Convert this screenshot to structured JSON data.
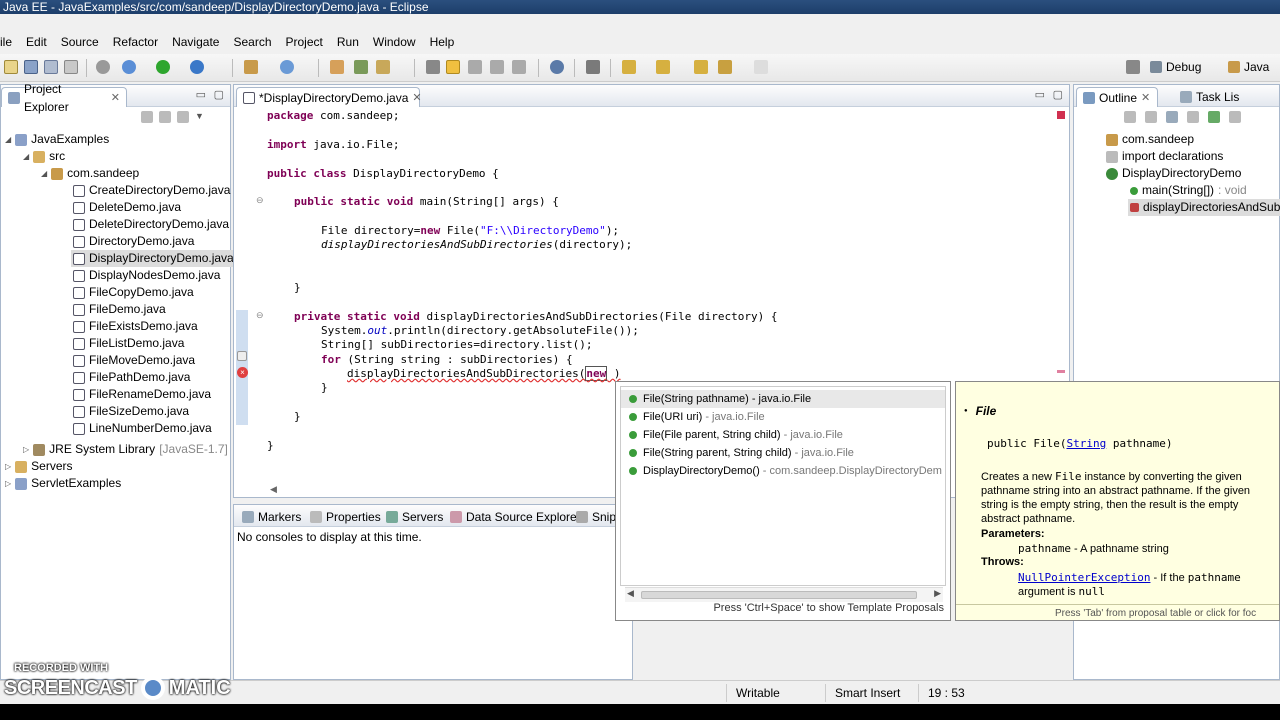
{
  "window": {
    "title": "Java EE - JavaExamples/src/com/sandeep/DisplayDirectoryDemo.java - Eclipse"
  },
  "menu": [
    "ile",
    "Edit",
    "Source",
    "Refactor",
    "Navigate",
    "Search",
    "Project",
    "Run",
    "Window",
    "Help"
  ],
  "perspectives": {
    "debug": "Debug",
    "java": "Java"
  },
  "project_explorer": {
    "tab": "Project Explorer",
    "items": [
      {
        "label": "JavaExamples"
      },
      {
        "label": "src"
      },
      {
        "label": "com.sandeep"
      },
      {
        "label": "CreateDirectoryDemo.java"
      },
      {
        "label": "DeleteDemo.java"
      },
      {
        "label": "DeleteDirectoryDemo.java"
      },
      {
        "label": "DirectoryDemo.java"
      },
      {
        "label": "DisplayDirectoryDemo.java"
      },
      {
        "label": "DisplayNodesDemo.java"
      },
      {
        "label": "FileCopyDemo.java"
      },
      {
        "label": "FileDemo.java"
      },
      {
        "label": "FileExistsDemo.java"
      },
      {
        "label": "FileListDemo.java"
      },
      {
        "label": "FileMoveDemo.java"
      },
      {
        "label": "FilePathDemo.java"
      },
      {
        "label": "FileRenameDemo.java"
      },
      {
        "label": "FileSizeDemo.java"
      },
      {
        "label": "LineNumberDemo.java"
      },
      {
        "label": "JRE System Library",
        "suffix": "[JavaSE-1.7]"
      },
      {
        "label": "Servers"
      },
      {
        "label": "ServletExamples"
      }
    ]
  },
  "editor": {
    "tab": "*DisplayDirectoryDemo.java",
    "lines": {
      "l1a": "package",
      "l1b": " com.sandeep;",
      "l2a": "import",
      "l2b": " java.io.File;",
      "l3a": "public class",
      "l3b": " DisplayDirectoryDemo {",
      "l4a": "public static void",
      "l4b": " main(String[] args) {",
      "l5a": "File directory=",
      "l5b": "new",
      "l5c": " File(",
      "l5d": "\"F:\\\\DirectoryDemo\"",
      "l5e": ");",
      "l6a": "displayDirectoriesAndSubDirectories",
      "l6b": "(directory);",
      "l7": "}",
      "l8a": "private static void",
      "l8b": " displayDirectoriesAndSubDirectories(File directory) {",
      "l9a": "System.",
      "l9b": "out",
      "l9c": ".println(directory.getAbsoluteFile());",
      "l10": "String[] subDirectories=directory.list();",
      "l11a": "for",
      "l11b": " (String string : subDirectories) {",
      "l12a": "displayDirectoriesAndSubDirectories(",
      "l12b": "new",
      "l12c": " )",
      "l13": "}",
      "l14": "}",
      "l15": "}"
    }
  },
  "bottom_panel": {
    "tabs": [
      "Markers",
      "Properties",
      "Servers",
      "Data Source Explorer",
      "Snip"
    ],
    "message": "No consoles to display at this time."
  },
  "outline": {
    "tab": "Outline",
    "tab2": "Task Lis",
    "items": [
      {
        "label": "com.sandeep"
      },
      {
        "label": "import declarations"
      },
      {
        "label": "DisplayDirectoryDemo"
      },
      {
        "label": "main(String[])",
        "suffix": ": void"
      },
      {
        "label": "displayDirectoriesAndSub"
      }
    ]
  },
  "completion": {
    "items": [
      {
        "label": "File(String pathname) - java.io.File",
        "detail": ""
      },
      {
        "label": "File(URI uri)",
        "detail": " - java.io.File"
      },
      {
        "label": "File(File parent, String child)",
        "detail": " - java.io.File"
      },
      {
        "label": "File(String parent, String child)",
        "detail": " - java.io.File"
      },
      {
        "label": "DisplayDirectoryDemo()",
        "detail": " - com.sandeep.DisplayDirectoryDem"
      }
    ],
    "footer": "Press 'Ctrl+Space' to show Template Proposals"
  },
  "javadoc": {
    "heading": "File",
    "signature_a": "public File(",
    "signature_link": "String",
    "signature_b": " pathname)",
    "desc_1": "Creates a new ",
    "desc_code": "File",
    "desc_2": " instance by converting the given pathname string into an abstract pathname. If the given string is the empty string, then the result is the empty abstract pathname.",
    "params_label": "Parameters:",
    "param_name": "pathname",
    "param_desc": " - A pathname string",
    "throws_label": "Throws:",
    "throws_link": "NullPointerException",
    "throws_desc_1": " - If the ",
    "throws_code": "pathname",
    "throws_desc_2": " argument is ",
    "throws_null": "null",
    "footer": "Press 'Tab' from proposal table or click for foc"
  },
  "status": {
    "writable": "Writable",
    "insert": "Smart Insert",
    "position": "19 : 53"
  },
  "watermark": {
    "line1": "RECORDED WITH",
    "line2": "SCREENCAST",
    "line3": "MATIC"
  },
  "colors": {
    "keyword": "#7f0055",
    "string": "#2a00ff",
    "link": "#0000cc",
    "doc_bg": "#ffffe1"
  }
}
